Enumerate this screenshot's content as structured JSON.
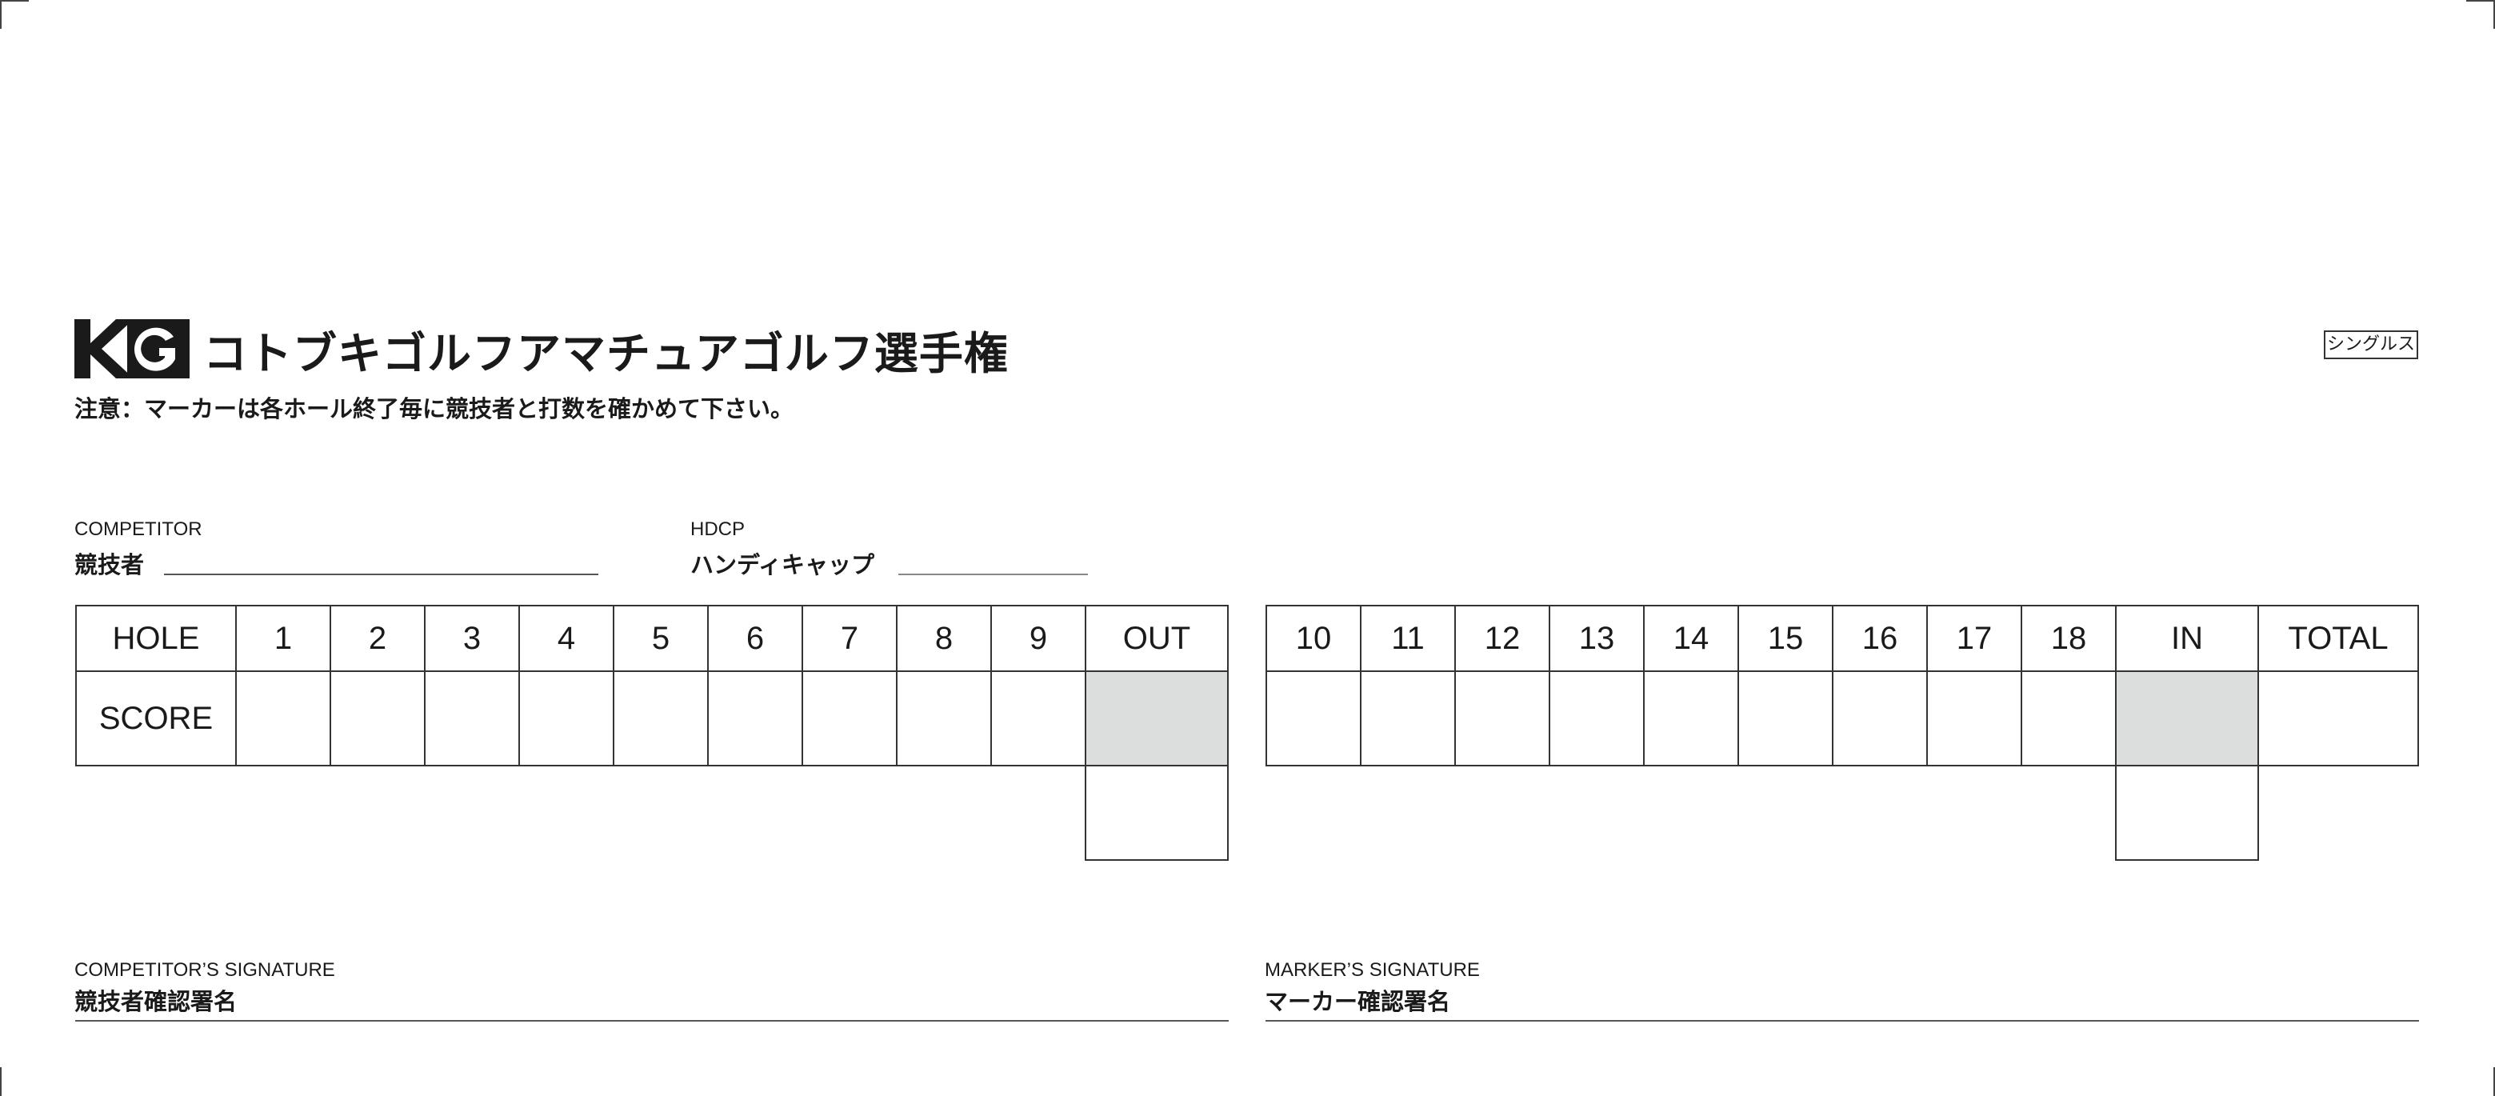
{
  "logo": {
    "text": "KG"
  },
  "title": "コトブキゴルフアマチュアゴルフ選手権",
  "notice": "注意：マーカーは各ホール終了毎に競技者と打数を確かめて下さい。",
  "badge": "シングルス",
  "competitor": {
    "label_en": "COMPETITOR",
    "label_jp": "競技者"
  },
  "hdcp": {
    "label_en": "HDCP",
    "label_jp": "ハンディキャップ"
  },
  "front": {
    "hole_label": "HOLE",
    "score_label": "SCORE",
    "holes": [
      "1",
      "2",
      "3",
      "4",
      "5",
      "6",
      "7",
      "8",
      "9"
    ],
    "total_label": "OUT"
  },
  "back": {
    "holes": [
      "10",
      "11",
      "12",
      "13",
      "14",
      "15",
      "16",
      "17",
      "18"
    ],
    "in_label": "IN",
    "total_label": "TOTAL"
  },
  "signatures": {
    "competitor_en": "COMPETITOR’S SIGNATURE",
    "competitor_jp": "競技者確認署名",
    "marker_en": "MARKER’S SIGNATURE",
    "marker_jp": "マーカー確認署名"
  },
  "colors": {
    "shaded_cell": "#dcdddd",
    "ink": "#1a1a1a"
  }
}
